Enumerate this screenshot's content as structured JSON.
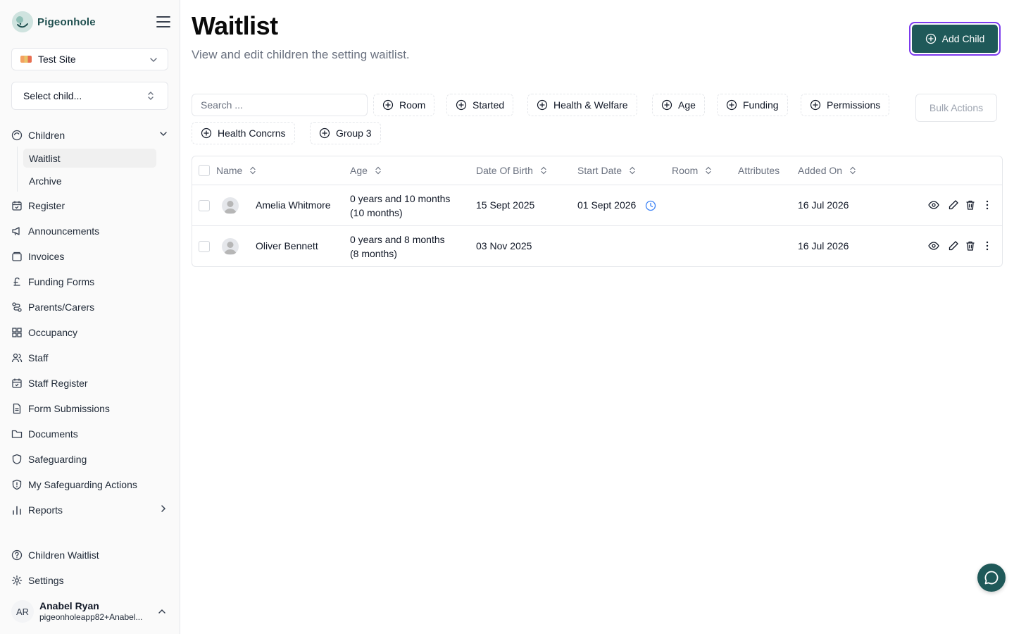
{
  "brand": {
    "name": "Pigeonhole"
  },
  "site_selector": {
    "value": "Test Site"
  },
  "child_selector": {
    "placeholder": "Select child..."
  },
  "nav": {
    "children": "Children",
    "children_sub": [
      "Waitlist",
      "Archive"
    ],
    "items": [
      "Register",
      "Announcements",
      "Invoices",
      "Funding Forms",
      "Parents/Carers",
      "Occupancy",
      "Staff",
      "Staff Register",
      "Form Submissions",
      "Documents",
      "Safeguarding",
      "My Safeguarding Actions",
      "Reports"
    ],
    "bottom": [
      "Children Waitlist",
      "Settings"
    ]
  },
  "user": {
    "initials": "AR",
    "name": "Anabel Ryan",
    "email": "pigeonholeapp82+Anabel..."
  },
  "page": {
    "title": "Waitlist",
    "subtitle": "View and edit children the setting waitlist.",
    "add_button": "Add Child"
  },
  "filters": {
    "search_placeholder": "Search ...",
    "chips": [
      "Room",
      "Started",
      "Health & Welfare",
      "Age",
      "Funding",
      "Permissions",
      "Health Concrns",
      "Group 3"
    ],
    "bulk_actions": "Bulk Actions"
  },
  "table": {
    "columns": [
      "Name",
      "Age",
      "Date Of Birth",
      "Start Date",
      "Room",
      "Attributes",
      "Added On"
    ],
    "rows": [
      {
        "name": "Amelia Whitmore",
        "age_line1": "0 years and 10 months",
        "age_line2": "(10 months)",
        "dob": "15 Sept 2025",
        "start_date": "01 Sept 2026",
        "room": "",
        "attributes": "",
        "added_on": "16 Jul 2026"
      },
      {
        "name": "Oliver Bennett",
        "age_line1": "0 years and 8 months",
        "age_line2": "(8 months)",
        "dob": "03 Nov 2025",
        "start_date": "",
        "room": "",
        "attributes": "",
        "added_on": "16 Jul 2026"
      }
    ]
  },
  "colors": {
    "accent": "#1f5959",
    "focus_ring": "#7c3aed",
    "clock": "#3b82f6"
  }
}
